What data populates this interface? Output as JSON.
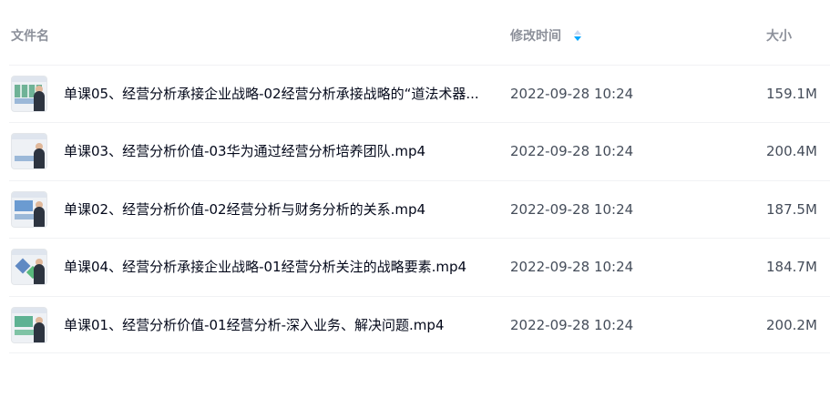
{
  "header": {
    "name_label": "文件名",
    "time_label": "修改时间",
    "size_label": "大小",
    "sort_icon": "sort-desc-icon",
    "sort_active_color": "#06a7ff"
  },
  "files": [
    {
      "name": "单课05、经营分析承接企业战略-02经营分析承接战略的“道法术器...",
      "modified": "2022-09-28 10:24",
      "size": "159.1M",
      "thumb_icon": "video-thumbnail-icon"
    },
    {
      "name": "单课03、经营分析价值-03华为通过经营分析培养团队.mp4",
      "modified": "2022-09-28 10:24",
      "size": "200.4M",
      "thumb_icon": "video-thumbnail-icon"
    },
    {
      "name": "单课02、经营分析价值-02经营分析与财务分析的关系.mp4",
      "modified": "2022-09-28 10:24",
      "size": "187.5M",
      "thumb_icon": "video-thumbnail-icon"
    },
    {
      "name": "单课04、经营分析承接企业战略-01经营分析关注的战略要素.mp4",
      "modified": "2022-09-28 10:24",
      "size": "184.7M",
      "thumb_icon": "video-thumbnail-icon"
    },
    {
      "name": "单课01、经营分析价值-01经营分析-深入业务、解决问题.mp4",
      "modified": "2022-09-28 10:24",
      "size": "200.2M",
      "thumb_icon": "video-thumbnail-icon"
    }
  ]
}
